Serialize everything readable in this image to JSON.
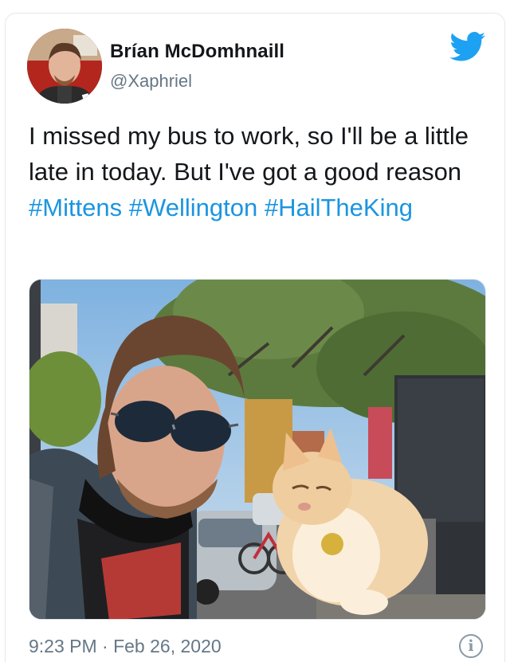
{
  "tweet": {
    "author_name": "Brían McDomhnaill",
    "author_handle": "@Xaphriel",
    "text_plain": "I missed my bus to work, so I'll be a little late in today. But I've got a good reason",
    "hashtags": [
      "#Mittens",
      "#Wellington",
      "#HailTheKing"
    ],
    "timestamp": "9:23 PM · Feb 26, 2020",
    "info_glyph": "i"
  },
  "icons": {
    "brand": "twitter-bird-icon",
    "info": "info-circle-icon"
  },
  "colors": {
    "link": "#1b95e0",
    "brand": "#1da1f2",
    "secondary_text": "#657786",
    "border": "#e1e8ed"
  }
}
